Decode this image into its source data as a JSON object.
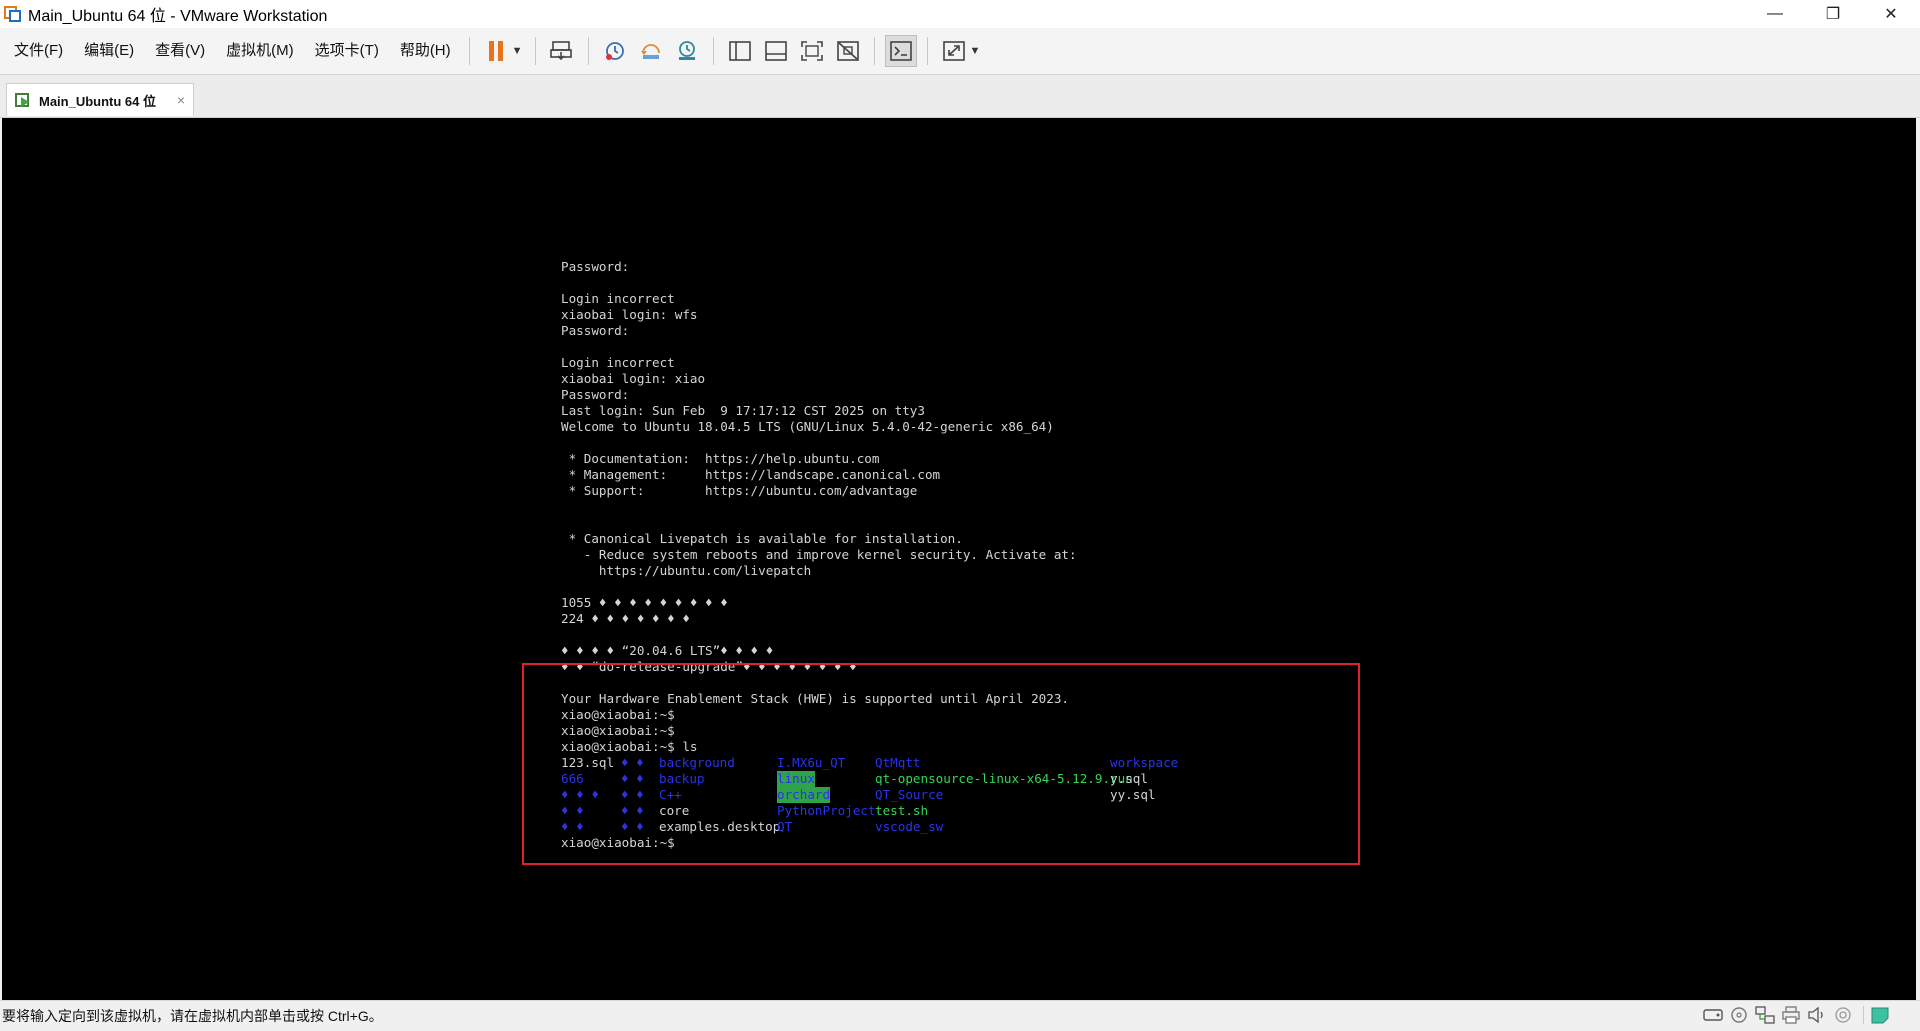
{
  "window": {
    "title": "Main_Ubuntu 64 位 - VMware Workstation",
    "minimize": "—",
    "restore": "❐",
    "close": "✕"
  },
  "menu": {
    "items": [
      "文件(F)",
      "编辑(E)",
      "查看(V)",
      "虚拟机(M)",
      "选项卡(T)",
      "帮助(H)"
    ]
  },
  "toolbar": {
    "icons": [
      "pause-icon",
      "send-ctrl-alt-del-icon",
      "snapshot-icon",
      "revert-snapshot-icon",
      "snapshot-manager-icon",
      "show-library-icon",
      "thumbnail-bar-icon",
      "full-screen-icon",
      "unity-icon",
      "console-view-icon",
      "stretch-guest-icon"
    ]
  },
  "tab": {
    "label": "Main_Ubuntu 64 位",
    "close": "×"
  },
  "terminal": {
    "lines": [
      "Password:",
      "",
      "Login incorrect",
      "xiaobai login: wfs",
      "Password:",
      "",
      "Login incorrect",
      "xiaobai login: xiao",
      "Password:",
      "Last login: Sun Feb  9 17:17:12 CST 2025 on tty3",
      "Welcome to Ubuntu 18.04.5 LTS (GNU/Linux 5.4.0-42-generic x86_64)",
      "",
      " * Documentation:  https://help.ubuntu.com",
      " * Management:     https://landscape.canonical.com",
      " * Support:        https://ubuntu.com/advantage",
      "",
      "",
      " * Canonical Livepatch is available for installation.",
      "   - Reduce system reboots and improve kernel security. Activate at:",
      "     https://ubuntu.com/livepatch",
      "",
      "1055 ♦ ♦ ♦ ♦ ♦ ♦ ♦ ♦ ♦",
      "224 ♦ ♦ ♦ ♦ ♦ ♦ ♦",
      "",
      "♦ ♦ ♦ ♦ “20.04.6 LTS”♦ ♦ ♦ ♦",
      "♦ ♦ “do-release-upgrade”♦ ♦ ♦ ♦ ♦ ♦ ♦ ♦",
      "",
      "Your Hardware Enablement Stack (HWE) is supported until April 2023.",
      "xiao@xiaobai:~$",
      "xiao@xiaobai:~$",
      "xiao@xiaobai:~$ ls"
    ],
    "ls_rows": [
      [
        "123.sql",
        "♦ ♦",
        "background",
        "I.MX6u_QT",
        "QtMqtt",
        "workspace"
      ],
      [
        "666",
        "♦ ♦",
        "backup",
        "linux",
        "qt-opensource-linux-x64-5.12.9.run",
        "y.sql"
      ],
      [
        "♦ ♦ ♦",
        "♦ ♦",
        "C++",
        "orchard",
        "QT_Source",
        "yy.sql"
      ],
      [
        "♦ ♦",
        "♦ ♦",
        "core",
        "PythonProject",
        "test.sh",
        ""
      ],
      [
        "♦ ♦",
        "♦ ♦",
        "examples.desktop",
        "QT",
        "vscode_sw",
        ""
      ]
    ],
    "final_prompt": "xiao@xiaobai:~$"
  },
  "status": {
    "text": "要将输入定向到该虚拟机，请在虚拟机内部单击或按 Ctrl+G。",
    "icons": [
      "hard-disk-icon",
      "cd-rom-icon",
      "network-icon",
      "printer-icon",
      "sound-icon",
      "usb-icon",
      "message-icon"
    ]
  },
  "colors": {
    "console_bg": "#000000",
    "terminal_text": "#d4d4d4",
    "directory_blue": "#2a33e6",
    "executable_green": "#33d655",
    "highlight_box": "#e0202a",
    "pause_orange": "#e9731c"
  }
}
